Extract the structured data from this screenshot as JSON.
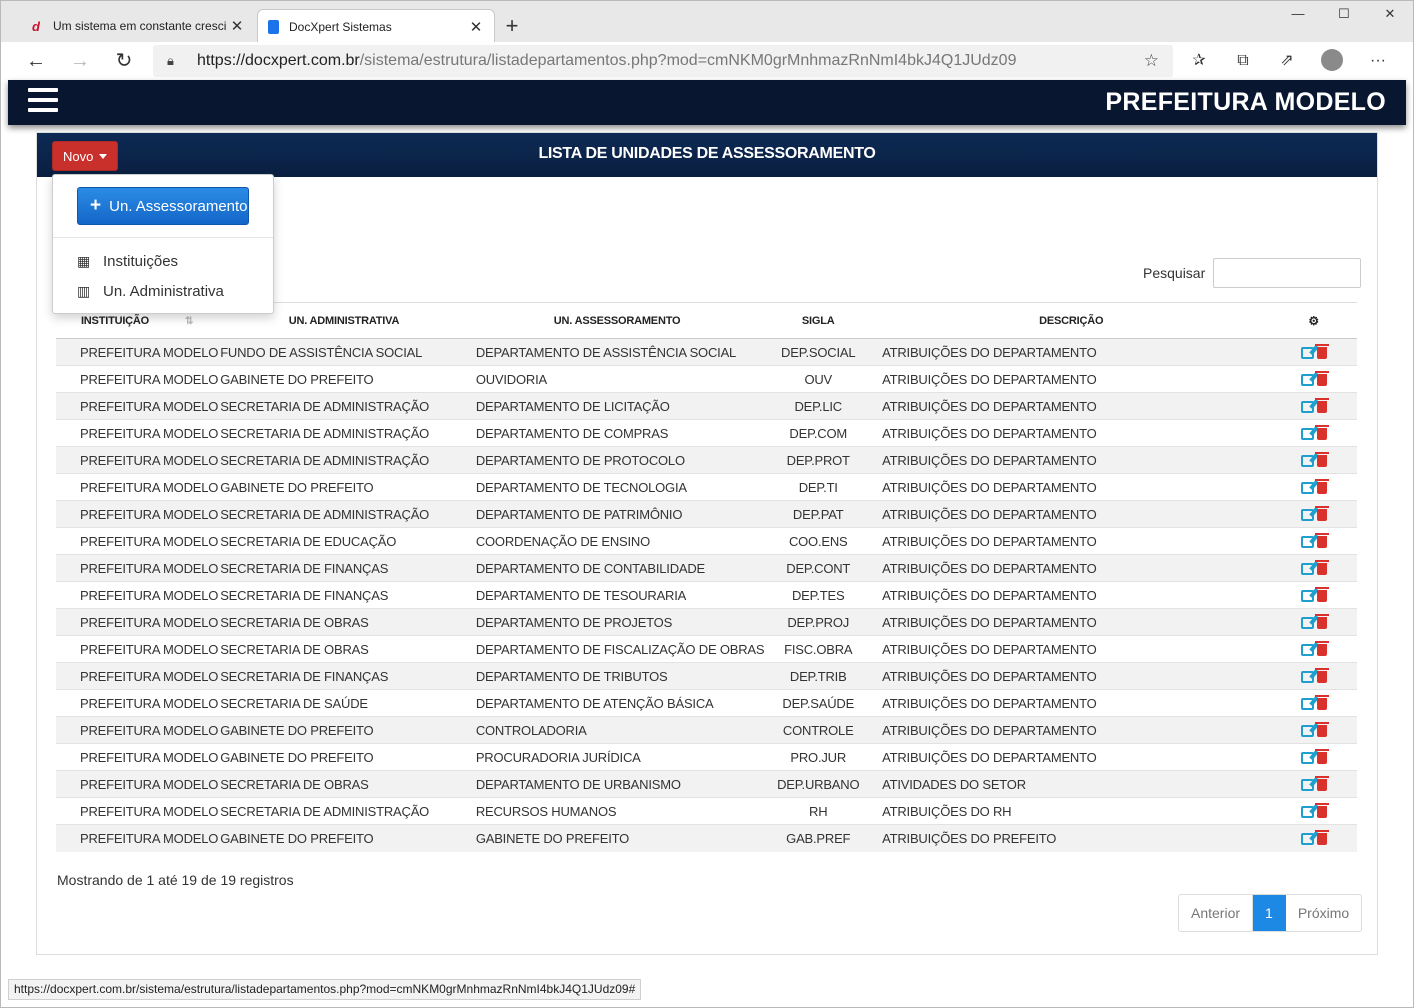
{
  "browser": {
    "tabs": [
      {
        "title": "Um sistema em constante cresci",
        "active": false
      },
      {
        "title": "DocXpert Sistemas",
        "active": true
      }
    ],
    "url_host": "https://docxpert.com.br",
    "url_path": "/sistema/estrutura/listadepartamentos.php?mod=cmNKM0grMnhmazRnNmI4bkJ4Q1JUdz09",
    "status_url": "https://docxpert.com.br/sistema/estrutura/listadepartamentos.php?mod=cmNKM0grMnhmazRnNmI4bkJ4Q1JUdz09#"
  },
  "app": {
    "title": "PREFEITURA MODELO"
  },
  "panel": {
    "title": "LISTA DE UNIDADES DE ASSESSORAMENTO",
    "new_button": "Novo"
  },
  "dropdown": {
    "primary": "Un. Assessoramento",
    "items": [
      "Instituições",
      "Un. Administrativa"
    ]
  },
  "search": {
    "label": "Pesquisar",
    "value": ""
  },
  "table": {
    "headers": [
      "INSTITUIÇÃO",
      "UN. ADMINISTRATIVA",
      "UN. ASSESSORAMENTO",
      "SIGLA",
      "DESCRIÇÃO"
    ],
    "rows": [
      [
        "PREFEITURA MODELO",
        "FUNDO DE ASSISTÊNCIA SOCIAL",
        "DEPARTAMENTO DE ASSISTÊNCIA SOCIAL",
        "DEP.SOCIAL",
        "ATRIBUIÇÕES DO DEPARTAMENTO"
      ],
      [
        "PREFEITURA MODELO",
        "GABINETE DO PREFEITO",
        "OUVIDORIA",
        "OUV",
        "ATRIBUIÇÕES DO DEPARTAMENTO"
      ],
      [
        "PREFEITURA MODELO",
        "SECRETARIA DE ADMINISTRAÇÃO",
        "DEPARTAMENTO DE LICITAÇÃO",
        "DEP.LIC",
        "ATRIBUIÇÕES DO DEPARTAMENTO"
      ],
      [
        "PREFEITURA MODELO",
        "SECRETARIA DE ADMINISTRAÇÃO",
        "DEPARTAMENTO DE COMPRAS",
        "DEP.COM",
        "ATRIBUIÇÕES DO DEPARTAMENTO"
      ],
      [
        "PREFEITURA MODELO",
        "SECRETARIA DE ADMINISTRAÇÃO",
        "DEPARTAMENTO DE PROTOCOLO",
        "DEP.PROT",
        "ATRIBUIÇÕES DO DEPARTAMENTO"
      ],
      [
        "PREFEITURA MODELO",
        "GABINETE DO PREFEITO",
        "DEPARTAMENTO DE TECNOLOGIA",
        "DEP.TI",
        "ATRIBUIÇÕES DO DEPARTAMENTO"
      ],
      [
        "PREFEITURA MODELO",
        "SECRETARIA DE ADMINISTRAÇÃO",
        "DEPARTAMENTO DE PATRIMÔNIO",
        "DEP.PAT",
        "ATRIBUIÇÕES DO DEPARTAMENTO"
      ],
      [
        "PREFEITURA MODELO",
        "SECRETARIA DE EDUCAÇÃO",
        "COORDENAÇÃO DE ENSINO",
        "COO.ENS",
        "ATRIBUIÇÕES DO DEPARTAMENTO"
      ],
      [
        "PREFEITURA MODELO",
        "SECRETARIA DE FINANÇAS",
        "DEPARTAMENTO DE CONTABILIDADE",
        "DEP.CONT",
        "ATRIBUIÇÕES DO DEPARTAMENTO"
      ],
      [
        "PREFEITURA MODELO",
        "SECRETARIA DE FINANÇAS",
        "DEPARTAMENTO DE TESOURARIA",
        "DEP.TES",
        "ATRIBUIÇÕES DO DEPARTAMENTO"
      ],
      [
        "PREFEITURA MODELO",
        "SECRETARIA DE OBRAS",
        "DEPARTAMENTO DE PROJETOS",
        "DEP.PROJ",
        "ATRIBUIÇÕES DO DEPARTAMENTO"
      ],
      [
        "PREFEITURA MODELO",
        "SECRETARIA DE OBRAS",
        "DEPARTAMENTO DE FISCALIZAÇÃO DE OBRAS",
        "FISC.OBRA",
        "ATRIBUIÇÕES DO DEPARTAMENTO"
      ],
      [
        "PREFEITURA MODELO",
        "SECRETARIA DE FINANÇAS",
        "DEPARTAMENTO DE TRIBUTOS",
        "DEP.TRIB",
        "ATRIBUIÇÕES DO DEPARTAMENTO"
      ],
      [
        "PREFEITURA MODELO",
        "SECRETARIA DE SAÚDE",
        "DEPARTAMENTO DE ATENÇÃO BÁSICA",
        "DEP.SAÚDE",
        "ATRIBUIÇÕES DO DEPARTAMENTO"
      ],
      [
        "PREFEITURA MODELO",
        "GABINETE DO PREFEITO",
        "CONTROLADORIA",
        "CONTROLE",
        "ATRIBUIÇÕES DO DEPARTAMENTO"
      ],
      [
        "PREFEITURA MODELO",
        "GABINETE DO PREFEITO",
        "PROCURADORIA JURÍDICA",
        "PRO.JUR",
        "ATRIBUIÇÕES DO DEPARTAMENTO"
      ],
      [
        "PREFEITURA MODELO",
        "SECRETARIA DE OBRAS",
        "DEPARTAMENTO DE URBANISMO",
        "DEP.URBANO",
        "ATIVIDADES DO SETOR"
      ],
      [
        "PREFEITURA MODELO",
        "SECRETARIA DE ADMINISTRAÇÃO",
        "RECURSOS HUMANOS",
        "RH",
        "ATRIBUIÇÕES DO RH"
      ],
      [
        "PREFEITURA MODELO",
        "GABINETE DO PREFEITO",
        "GABINETE DO PREFEITO",
        "GAB.PREF",
        "ATRIBUIÇÕES DO PREFEITO"
      ]
    ]
  },
  "footer": {
    "info": "Mostrando de 1 até 19 de 19 registros",
    "prev": "Anterior",
    "page": "1",
    "next": "Próximo"
  },
  "colors": {
    "header_bg": "#081630",
    "novo_button": "#c9302c",
    "primary_button": "#1e88e5",
    "edit_icon": "#1f9fcd",
    "delete_icon": "#d9312b"
  }
}
